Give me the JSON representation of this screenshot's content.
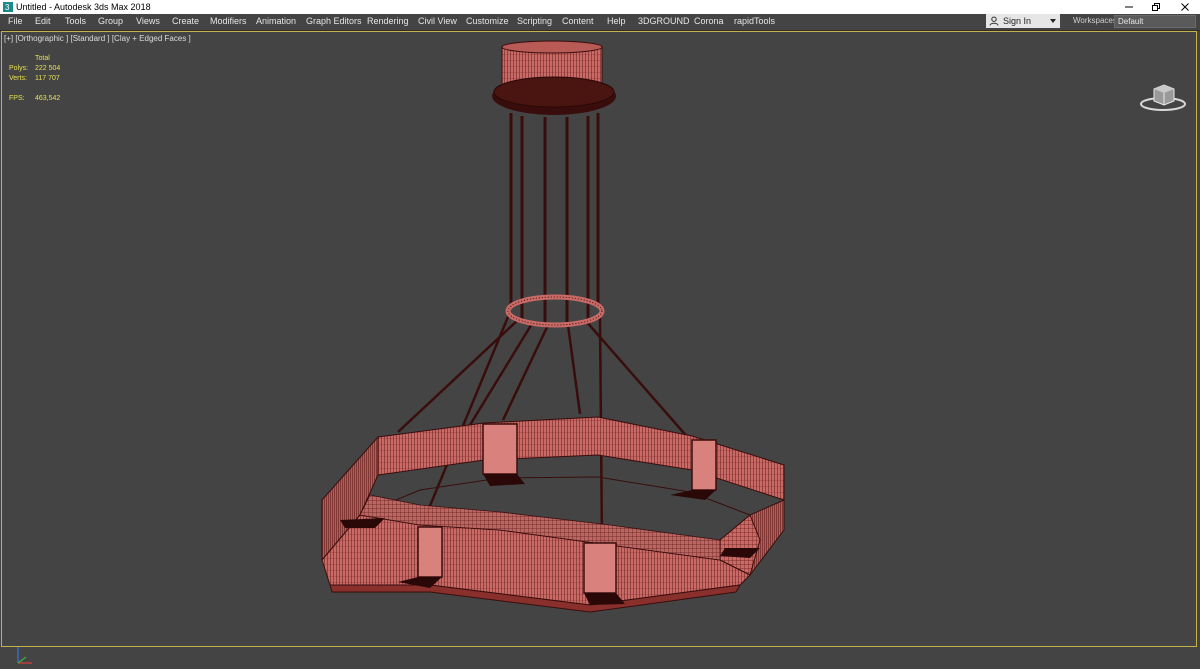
{
  "window": {
    "title": "Untitled - Autodesk 3ds Max 2018",
    "icon": "3ds-max-app-icon",
    "controls": [
      "minimize-icon",
      "restore-icon",
      "close-icon"
    ]
  },
  "menu": {
    "items": [
      "File",
      "Edit",
      "Tools",
      "Group",
      "Views",
      "Create",
      "Modifiers",
      "Animation",
      "Graph Editors",
      "Rendering",
      "Civil View",
      "Customize",
      "Scripting",
      "Content",
      "Help",
      "3DGROUND",
      "Corona",
      "rapidTools"
    ]
  },
  "signin": {
    "label": "Sign In",
    "icon": "user-icon"
  },
  "workspaces": {
    "label": "Workspaces:",
    "value": "Default"
  },
  "viewport": {
    "label": "[+] [Orthographic ] [Standard ] [Clay + Edged Faces ]",
    "stats": {
      "total_label": "Total",
      "polys_label": "Polys:",
      "polys_value": "222 504",
      "verts_label": "Verts:",
      "verts_value": "117 707",
      "fps_label": "FPS:",
      "fps_value": "463,542"
    }
  },
  "scene": {
    "object": "hexagonal-pendant-chandelier",
    "clay_color": "#c96a66",
    "wire_color": "#3a0d0d",
    "background": "#444444",
    "viewport_border_color": "#c7b24a"
  }
}
